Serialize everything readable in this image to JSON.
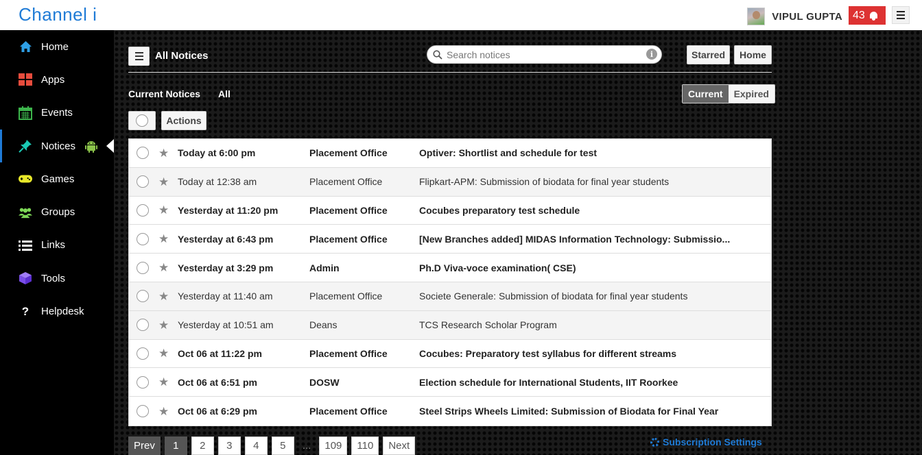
{
  "brand": "Channel i",
  "user": {
    "name": "VIPUL GUPTA",
    "notification_count": "43"
  },
  "sidebar": {
    "items": [
      {
        "label": "Home",
        "icon": "home-icon",
        "color": "#2e9fe6"
      },
      {
        "label": "Apps",
        "icon": "apps-grid-icon",
        "color": "#e84c3d"
      },
      {
        "label": "Events",
        "icon": "calendar-icon",
        "color": "#3cb44b"
      },
      {
        "label": "Notices",
        "icon": "pin-icon",
        "color": "#1ac9b4"
      },
      {
        "label": "Games",
        "icon": "gamepad-icon",
        "color": "#e8e82a"
      },
      {
        "label": "Groups",
        "icon": "users-icon",
        "color": "#7ed957"
      },
      {
        "label": "Links",
        "icon": "list-icon",
        "color": "#ffffff"
      },
      {
        "label": "Tools",
        "icon": "cube-icon",
        "color": "#8a5cf5"
      },
      {
        "label": "Helpdesk",
        "icon": "question-icon",
        "color": "#ffffff"
      }
    ]
  },
  "main": {
    "title": "All Notices",
    "search_placeholder": "Search notices",
    "starred_label": "Starred",
    "home_label": "Home",
    "filter_current": "Current Notices",
    "filter_all": "All",
    "seg_current": "Current",
    "seg_expired": "Expired",
    "actions_label": "Actions"
  },
  "notices": [
    {
      "date": "Today at 6:00 pm",
      "from": "Placement Office",
      "subject": "Optiver: Shortlist and schedule for test",
      "read": false
    },
    {
      "date": "Today at 12:38 am",
      "from": "Placement Office",
      "subject": "Flipkart-APM: Submission of biodata for final year students",
      "read": true
    },
    {
      "date": "Yesterday at 11:20 pm",
      "from": "Placement Office",
      "subject": "Cocubes preparatory test schedule",
      "read": false
    },
    {
      "date": "Yesterday at 6:43 pm",
      "from": "Placement Office",
      "subject": "[New Branches added] MIDAS Information Technology: Submissio...",
      "read": false
    },
    {
      "date": "Yesterday at 3:29 pm",
      "from": "Admin",
      "subject": "Ph.D Viva-voce examination( CSE)",
      "read": false
    },
    {
      "date": "Yesterday at 11:40 am",
      "from": "Placement Office",
      "subject": "Societe Generale: Submission of biodata for final year students",
      "read": true
    },
    {
      "date": "Yesterday at 10:51 am",
      "from": "Deans",
      "subject": "TCS Research Scholar Program",
      "read": true
    },
    {
      "date": "Oct 06 at 11:22 pm",
      "from": "Placement Office",
      "subject": "Cocubes: Preparatory test syllabus for different streams",
      "read": false
    },
    {
      "date": "Oct 06 at 6:51 pm",
      "from": "DOSW",
      "subject": "Election schedule for International Students, IIT Roorkee",
      "read": false
    },
    {
      "date": "Oct 06 at 6:29 pm",
      "from": "Placement Office",
      "subject": "Steel Strips Wheels Limited: Submission of Biodata for Final Year",
      "read": false
    }
  ],
  "pager": {
    "prev": "Prev",
    "pages": [
      "1",
      "2",
      "3",
      "4",
      "5"
    ],
    "dots": "...",
    "last_pages": [
      "109",
      "110"
    ],
    "next": "Next",
    "current": "1"
  },
  "subscription_settings": "Subscription Settings"
}
